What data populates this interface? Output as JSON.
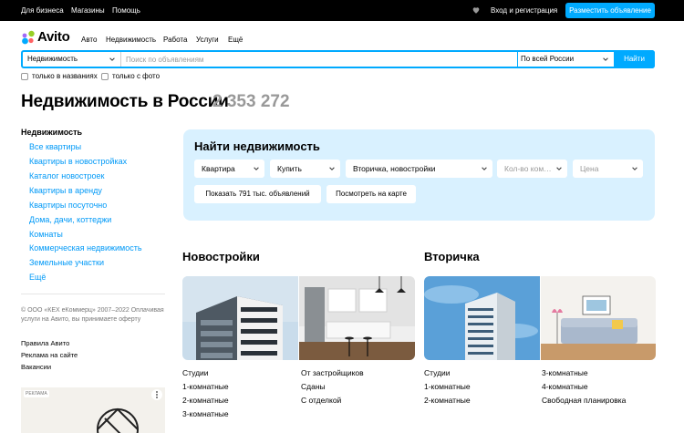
{
  "topbar": {
    "business": "Для бизнеса",
    "shops": "Магазины",
    "help": "Помощь",
    "login": "Вход и регистрация",
    "post_ad": "Разместить объявление"
  },
  "brand": {
    "name": "Avito",
    "accent": "#00aaff"
  },
  "nav": [
    "Авто",
    "Недвижимость",
    "Работа",
    "Услуги",
    "Ещё"
  ],
  "search": {
    "category": "Недвижимость",
    "placeholder": "Поиск по объявлениям",
    "region": "По всей России",
    "button": "Найти",
    "only_titles": "только в названиях",
    "only_photo": "только с фото"
  },
  "page": {
    "title": "Недвижимость в России",
    "count": "2 353 272"
  },
  "sidebar": {
    "heading": "Недвижимость",
    "items": [
      "Все квартиры",
      "Квартиры в новостройках",
      "Каталог новостроек",
      "Квартиры в аренду",
      "Квартиры посуточно",
      "Дома, дачи, коттеджи",
      "Комнаты",
      "Коммерческая недвижимость",
      "Земельные участки",
      "Ещё"
    ],
    "copyright": "© ООО «КЕХ еКоммерц» 2007–2022 Оплачивая услуги на Авито, вы принимаете оферту",
    "footer_links": [
      "Правила Авито",
      "Реклама на сайте",
      "Вакансии"
    ],
    "ad_tag": "РЕКЛАМА"
  },
  "finder": {
    "title": "Найти недвижимость",
    "type": "Квартира",
    "deal": "Купить",
    "market": "Вторичка, новостройки",
    "rooms_placeholder": "Кол-во ком…",
    "price_placeholder": "Цена",
    "show_button": "Показать 791 тыс. объявлений",
    "map_button": "Посмотреть на карте"
  },
  "new_buildings": {
    "title": "Новостройки",
    "col1": [
      "Студии",
      "1-комнатные",
      "2-комнатные",
      "3-комнатные"
    ],
    "col2": [
      "От застройщиков",
      "Сданы",
      "С отделкой"
    ]
  },
  "resale": {
    "title": "Вторичка",
    "col1": [
      "Студии",
      "1-комнатные",
      "2-комнатные"
    ],
    "col2": [
      "3-комнатные",
      "4-комнатные",
      "Свободная планировка"
    ]
  }
}
